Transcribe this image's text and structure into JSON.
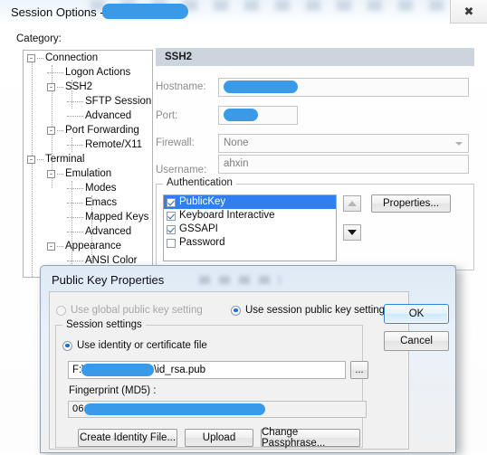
{
  "window": {
    "title": "Session Options -",
    "close_icon": "close-icon",
    "category_label": "Category:"
  },
  "tree": {
    "items": [
      {
        "label": "Connection",
        "depth": 0,
        "toggle": "-"
      },
      {
        "label": "Logon Actions",
        "depth": 1,
        "toggle": ""
      },
      {
        "label": "SSH2",
        "depth": 1,
        "toggle": "-"
      },
      {
        "label": "SFTP Session",
        "depth": 2,
        "toggle": ""
      },
      {
        "label": "Advanced",
        "depth": 2,
        "toggle": ""
      },
      {
        "label": "Port Forwarding",
        "depth": 1,
        "toggle": "-"
      },
      {
        "label": "Remote/X11",
        "depth": 2,
        "toggle": ""
      },
      {
        "label": "Terminal",
        "depth": 0,
        "toggle": "-"
      },
      {
        "label": "Emulation",
        "depth": 1,
        "toggle": "-"
      },
      {
        "label": "Modes",
        "depth": 2,
        "toggle": ""
      },
      {
        "label": "Emacs",
        "depth": 2,
        "toggle": ""
      },
      {
        "label": "Mapped Keys",
        "depth": 2,
        "toggle": ""
      },
      {
        "label": "Advanced",
        "depth": 2,
        "toggle": ""
      },
      {
        "label": "Appearance",
        "depth": 1,
        "toggle": "-"
      },
      {
        "label": "ANSI Color",
        "depth": 2,
        "toggle": ""
      }
    ]
  },
  "ssh2": {
    "header": "SSH2",
    "hostname_label": "Hostname:",
    "hostname_value": "",
    "port_label": "Port:",
    "port_value": "",
    "firewall_label": "Firewall:",
    "firewall_value": "None",
    "username_label": "Username:",
    "username_value": "ahxin"
  },
  "authentication": {
    "legend": "Authentication",
    "items": [
      {
        "label": "PublicKey",
        "checked": true,
        "selected": true
      },
      {
        "label": "Keyboard Interactive",
        "checked": true,
        "selected": false
      },
      {
        "label": "GSSAPI",
        "checked": true,
        "selected": false
      },
      {
        "label": "Password",
        "checked": false,
        "selected": false
      }
    ],
    "move_up_icon": "arrow-up-icon",
    "move_down_icon": "arrow-down-icon",
    "properties_button": "Properties..."
  },
  "dialog": {
    "title": "Public Key Properties",
    "radio_global": "Use global public key setting",
    "radio_session": "Use session public key setting",
    "session_group_legend": "Session settings",
    "radio_identity_file": "Use identity or certificate file",
    "path_value": "F:\\data\\aliyun.ssh\\id_rsa.pub",
    "browse_button": "...",
    "fingerprint_label": "Fingerprint (MD5) :",
    "fingerprint_value": "06:                                        3:6e",
    "create_identity_button": "Create Identity File...",
    "upload_button": "Upload",
    "change_passphrase_button": "Change Passphrase...",
    "ok_button": "OK",
    "cancel_button": "Cancel"
  },
  "colors": {
    "selection_blue": "#2f7ff0",
    "redaction_blue": "#3b9ae8",
    "header_band": "#ccd4de",
    "focus_blue": "#2c86d6"
  }
}
